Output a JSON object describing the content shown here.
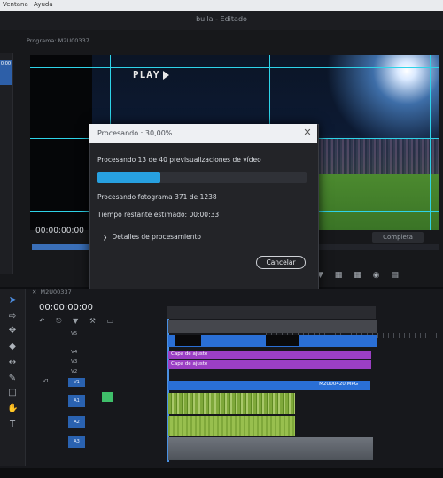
{
  "menubar": {
    "items": [
      "Ventana",
      "Ayuda"
    ]
  },
  "window": {
    "title": "bulla",
    "status": "Editado"
  },
  "program_monitor": {
    "header": "Programa: M2U00337",
    "overlay_text": "PLAY",
    "timecode": "00:00:00:00",
    "left_timecode": "0:00",
    "quality": "Completa"
  },
  "dialog": {
    "title": "Procesando : 30,00%",
    "line1": "Procesando 13 de 40 previsualizaciones de vídeo",
    "progress": 0.3,
    "line2": "Procesando fotograma 371 de 1238",
    "line3": "Tiempo restante estimado: 00:00:33",
    "details_label": "Detalles de procesamiento",
    "cancel_label": "Cancelar"
  },
  "timeline": {
    "tab": "M2U00337",
    "timecode": "00:00:00:00",
    "tracks_video": [
      "V5",
      "V4",
      "V3",
      "V2",
      "V1"
    ],
    "tracks_audio": [
      "A1",
      "A2",
      "A3"
    ],
    "source_label": "V1",
    "clips": {
      "adj1": "Capa de ajuste",
      "adj2": "Capa de ajuste",
      "main": "M2U00420.MPG"
    }
  },
  "colors": {
    "accent": "#27a0e0",
    "guide": "#2ed3e8",
    "adjustment": "#9b3fc4",
    "video_clip": "#2a6fd6",
    "audio_clip": "#7fa83a"
  }
}
